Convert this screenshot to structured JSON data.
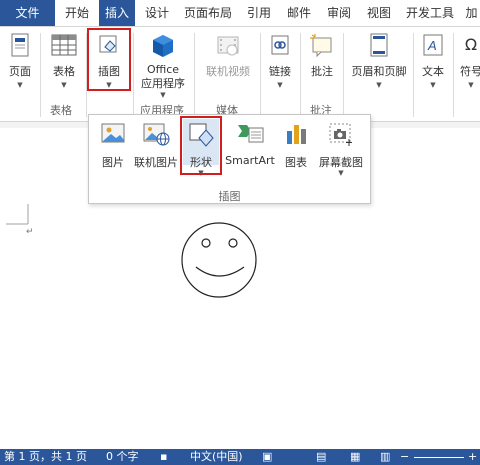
{
  "tabs": {
    "file": "文件",
    "items": [
      "开始",
      "插入",
      "设计",
      "页面布局",
      "引用",
      "邮件",
      "审阅",
      "视图",
      "开发工具",
      "加"
    ]
  },
  "ribbon": {
    "cover": {
      "label": "页面"
    },
    "table": {
      "label": "表格"
    },
    "illustrations": {
      "label": "插图"
    },
    "office": {
      "line1": "Office",
      "line2": "应用程序"
    },
    "online_video": {
      "label": "联机视频"
    },
    "link": {
      "label": "链接"
    },
    "comment": {
      "label": "批注"
    },
    "header_footer": {
      "label": "页眉和页脚"
    },
    "text": {
      "label": "文本"
    },
    "symbol": {
      "label": "符号"
    },
    "groups": {
      "table": "表格",
      "apps": "应用程序",
      "media": "媒体",
      "comments": "批注"
    }
  },
  "dropdown": {
    "items": [
      "图片",
      "联机图片",
      "形状",
      "SmartArt",
      "图表",
      "屏幕截图"
    ],
    "group_label": "插图"
  },
  "status": {
    "page": "第 1 页，共 1 页",
    "words": "0 个字",
    "language": "中文(中国)"
  },
  "colors": {
    "accent": "#2b579a",
    "highlight_box": "#d11f1f"
  }
}
